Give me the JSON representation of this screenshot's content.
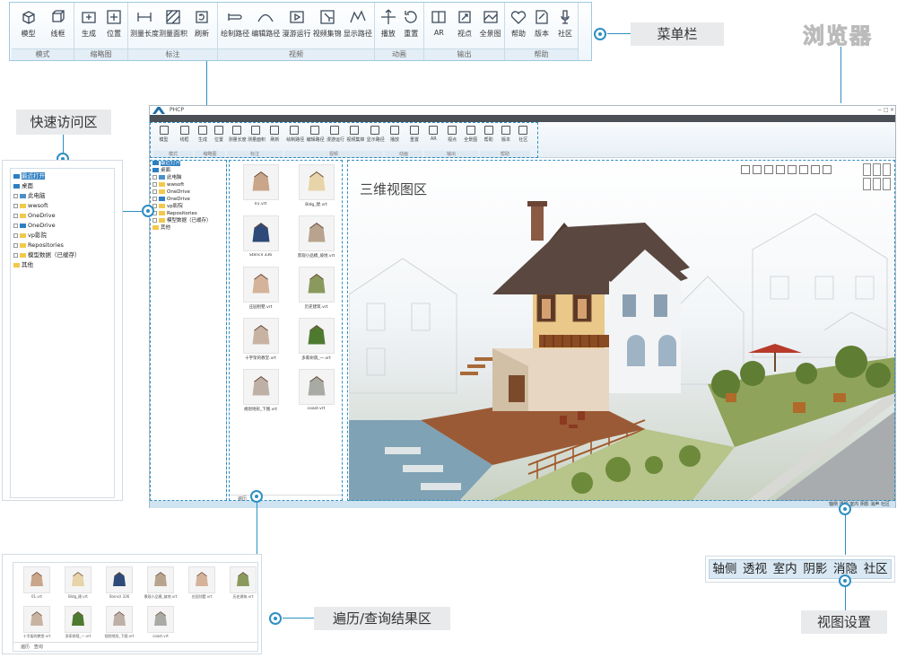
{
  "menu_bar": {
    "groups": [
      {
        "title": "模式",
        "buttons": [
          {
            "label": "模型",
            "icon": "cube-icon"
          },
          {
            "label": "线框",
            "icon": "wireframe-cube-icon"
          }
        ]
      },
      {
        "title": "缩略图",
        "buttons": [
          {
            "label": "生成",
            "icon": "generate-thumbnail-icon"
          },
          {
            "label": "位置",
            "icon": "position-icon"
          }
        ]
      },
      {
        "title": "标注",
        "buttons": [
          {
            "label": "测量长度",
            "icon": "measure-length-icon"
          },
          {
            "label": "测量面积",
            "icon": "measure-area-icon"
          },
          {
            "label": "刷新",
            "icon": "refresh-icon"
          }
        ]
      },
      {
        "title": "视频",
        "buttons": [
          {
            "label": "绘制路径",
            "icon": "draw-path-icon"
          },
          {
            "label": "编辑路径",
            "icon": "edit-path-icon"
          },
          {
            "label": "漫游运行",
            "icon": "play-roam-icon"
          },
          {
            "label": "视频集锦",
            "icon": "video-collection-icon"
          },
          {
            "label": "显示路径",
            "icon": "show-path-icon"
          }
        ]
      },
      {
        "title": "动画",
        "buttons": [
          {
            "label": "播放",
            "icon": "play-animation-icon"
          },
          {
            "label": "重置",
            "icon": "reset-icon"
          }
        ]
      },
      {
        "title": "输出",
        "buttons": [
          {
            "label": "AR",
            "icon": "ar-icon"
          },
          {
            "label": "视点",
            "icon": "viewpoint-icon"
          },
          {
            "label": "全景图",
            "icon": "panorama-icon"
          }
        ]
      },
      {
        "title": "帮助",
        "buttons": [
          {
            "label": "帮助",
            "icon": "help-icon"
          },
          {
            "label": "版本",
            "icon": "version-icon"
          },
          {
            "label": "社区",
            "icon": "community-icon"
          }
        ]
      }
    ]
  },
  "callouts": {
    "menu_bar": "菜单栏",
    "browser": "浏览器",
    "quick_access": "快速访问区",
    "view3d": "三维视图区",
    "results": "遍历/查询结果区",
    "view_settings": "视图设置"
  },
  "window": {
    "title": "PHCP",
    "controls": [
      "−",
      "□",
      "×"
    ],
    "status_text": "轴侧 透视 室内 阴影 消声 社区"
  },
  "tree": {
    "items": [
      {
        "label": "最近打开",
        "kind": "star",
        "selected": true
      },
      {
        "label": "桌面",
        "kind": "desktop"
      },
      {
        "label": "此电脑",
        "kind": "pc",
        "expander": true
      },
      {
        "label": "wwsoft",
        "kind": "folder",
        "expander": true
      },
      {
        "label": "OneDrive",
        "kind": "folder",
        "expander": true
      },
      {
        "label": "OneDrive",
        "kind": "cloud",
        "expander": true
      },
      {
        "label": "vp影院",
        "kind": "folder",
        "expander": true
      },
      {
        "label": "Repositories",
        "kind": "folder",
        "expander": true
      },
      {
        "label": "模型数据（已缓存）",
        "kind": "folder",
        "expander": true
      },
      {
        "label": "其他",
        "kind": "folder"
      }
    ]
  },
  "results": {
    "items": [
      {
        "name": "01.vrt",
        "thumb": "#c9a58a"
      },
      {
        "name": "Bldg_建.vrt",
        "thumb": "#e7d4a8"
      },
      {
        "name": "Stencil 336",
        "thumb": "#2d4a78"
      },
      {
        "name": "景观小品模_坡地.vrt",
        "thumb": "#b8a48e"
      },
      {
        "name": "庄园别墅.vrt",
        "thumb": "#d5b39a"
      },
      {
        "name": "历史建筑.vrt",
        "thumb": "#8a9a5c"
      },
      {
        "name": "十字架的教堂.vrt",
        "thumb": "#c8b3a3"
      },
      {
        "name": "多家树荫_一.vrt",
        "thumb": "#4e7a2f"
      },
      {
        "name": "规划地形_下图.vrt",
        "thumb": "#bfb0a6"
      },
      {
        "name": "coast.vrt",
        "thumb": "#a8aaa4"
      }
    ],
    "footer": [
      "遍历",
      "查询"
    ]
  },
  "view_settings": {
    "buttons": [
      "轴侧",
      "透视",
      "室内",
      "阴影",
      "消隐",
      "社区"
    ]
  }
}
